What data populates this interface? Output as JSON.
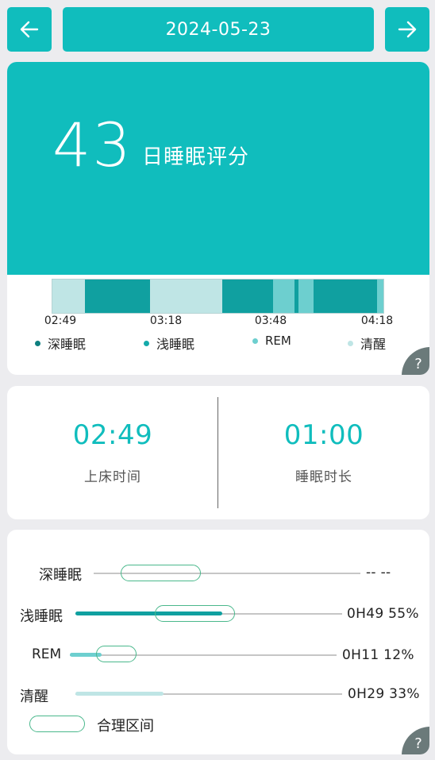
{
  "header": {
    "date": "2024-05-23",
    "prev_icon": "arrow-left-icon",
    "next_icon": "arrow-right-icon"
  },
  "score_card": {
    "score": "43",
    "score_label": "日睡眠评分",
    "timeline_ticks": [
      "02:49",
      "03:18",
      "03:48",
      "04:18"
    ],
    "legend": [
      {
        "label": "深睡眠",
        "color": "#14a3a3"
      },
      {
        "label": "浅睡眠",
        "color": "#15aaaa"
      },
      {
        "label": "REM",
        "color": "#6dcfcf"
      },
      {
        "label": "清醒",
        "color": "#bfe5e5"
      }
    ],
    "stage_colors": {
      "deep": "#14a3a3",
      "light": "#10a0a0",
      "rem": "#6dcfcf",
      "awake": "#bfe5e5"
    },
    "help_icon": "?"
  },
  "summary_card": {
    "bedtime_value": "02:49",
    "bedtime_label": "上床时间",
    "duration_value": "01:00",
    "duration_label": "睡眠时长"
  },
  "stages_card": {
    "rows": [
      {
        "label": "深睡眠",
        "value": "-- --",
        "fraction": 0
      },
      {
        "label": "浅睡眠",
        "value": "0H49 55%",
        "fraction": 0.55
      },
      {
        "label": "REM",
        "value": "0H11 12%",
        "fraction": 0.12
      },
      {
        "label": "清醒",
        "value": "0H29 33%",
        "fraction": 0.33
      }
    ],
    "legend_label": "合理区间",
    "help_icon": "?"
  }
}
